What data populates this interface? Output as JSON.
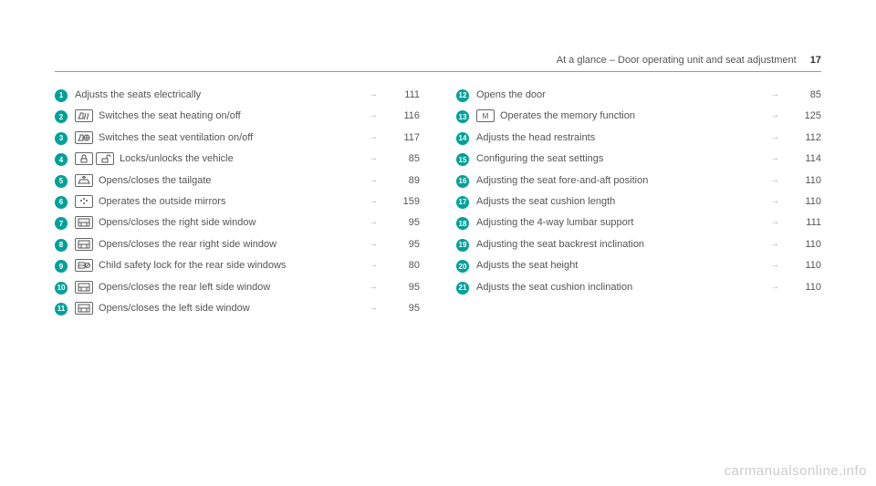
{
  "header": {
    "title": "At a glance – Door operating unit and seat adjustment",
    "page_number": "17"
  },
  "arrow_glyph": "→",
  "left_items": [
    {
      "num": "1",
      "icons": [],
      "text": "Adjusts the seats electrically",
      "page": "111"
    },
    {
      "num": "2",
      "icons": [
        "seat-heating"
      ],
      "text": "Switches the seat heating on/off",
      "page": "116"
    },
    {
      "num": "3",
      "icons": [
        "seat-ventilation"
      ],
      "text": "Switches the seat ventilation on/off",
      "page": "117"
    },
    {
      "num": "4",
      "icons": [
        "lock",
        "unlock"
      ],
      "text": "Locks/unlocks the vehicle",
      "page": "85"
    },
    {
      "num": "5",
      "icons": [
        "tailgate"
      ],
      "text": "Opens/closes the tailgate",
      "page": "89"
    },
    {
      "num": "6",
      "icons": [
        "mirrors"
      ],
      "text": "Operates the outside mirrors",
      "page": "159"
    },
    {
      "num": "7",
      "icons": [
        "window-right"
      ],
      "text": "Opens/closes the right side window",
      "page": "95"
    },
    {
      "num": "8",
      "icons": [
        "window-rear-right"
      ],
      "text": "Opens/closes the rear right side window",
      "page": "95"
    },
    {
      "num": "9",
      "icons": [
        "child-lock"
      ],
      "text": "Child safety lock for the rear side windows",
      "page": "80"
    },
    {
      "num": "10",
      "icons": [
        "window-rear-left"
      ],
      "text": "Opens/closes the rear left side window",
      "page": "95"
    },
    {
      "num": "11",
      "icons": [
        "window-left"
      ],
      "text": "Opens/closes the left side window",
      "page": "95"
    }
  ],
  "right_items": [
    {
      "num": "12",
      "icons": [],
      "text": "Opens the door",
      "page": "85"
    },
    {
      "num": "13",
      "icons": [
        "memory"
      ],
      "text": "Operates the memory function",
      "page": "125"
    },
    {
      "num": "14",
      "icons": [],
      "text": "Adjusts the head restraints",
      "page": "112"
    },
    {
      "num": "15",
      "icons": [],
      "text": "Configuring the seat settings",
      "page": "114"
    },
    {
      "num": "16",
      "icons": [],
      "text": "Adjusting the seat fore-and-aft position",
      "page": "110"
    },
    {
      "num": "17",
      "icons": [],
      "text": "Adjusts the seat cushion length",
      "page": "110"
    },
    {
      "num": "18",
      "icons": [],
      "text": "Adjusting the 4-way lumbar support",
      "page": "111"
    },
    {
      "num": "19",
      "icons": [],
      "text": "Adjusting the seat backrest inclination",
      "page": "110"
    },
    {
      "num": "20",
      "icons": [],
      "text": "Adjusts the seat height",
      "page": "110"
    },
    {
      "num": "21",
      "icons": [],
      "text": "Adjusts the seat cushion inclination",
      "page": "110"
    }
  ],
  "watermark": "carmanualsonline.info"
}
